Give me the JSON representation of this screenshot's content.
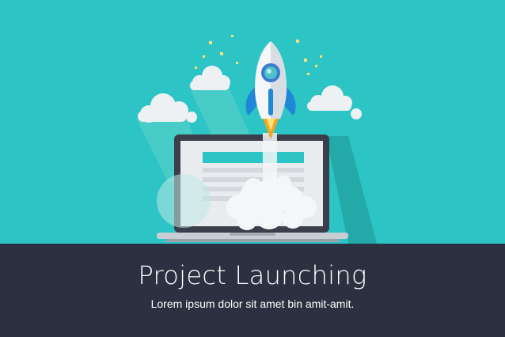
{
  "banner": {
    "title": "Project Launching",
    "subtitle": "Lorem ipsum dolor sit amet bin amit-amit."
  },
  "colors": {
    "sky": "#2cc4c4",
    "banner_bg": "#2c3142",
    "laptop_frame": "#3a3f4b",
    "rocket_body": "#f4f6f8",
    "rocket_fins": "#1e88d6",
    "flame": "#f5a623",
    "sparkle": "#f7e27a"
  },
  "icons": [
    "rocket-icon",
    "laptop-icon",
    "cloud-icon",
    "sparkle-icon"
  ]
}
